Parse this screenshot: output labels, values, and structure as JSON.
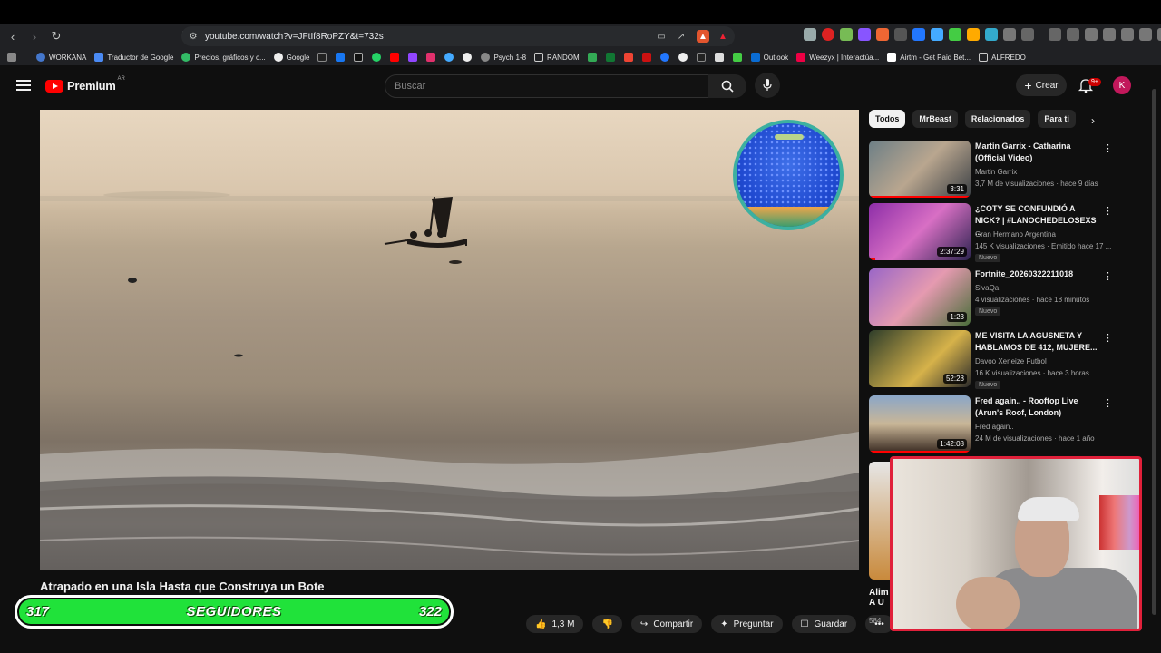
{
  "browser": {
    "url": "youtube.com/watch?v=JFtIf8RoPZY&t=732s",
    "bookmarks": [
      "WORKANA",
      "Traductor de Google",
      "Precios, gráficos y c...",
      "Google",
      "Psych 1-8",
      "RANDOM",
      "Outlook",
      "Weezyx | Interactúa...",
      "Airtm - Get Paid Bet...",
      "ALFREDO"
    ]
  },
  "youtube": {
    "logo_text": "Premium",
    "country": "AR",
    "search_placeholder": "Buscar",
    "create_label": "Crear",
    "notif_badge": "9+",
    "avatar_letter": "K"
  },
  "video": {
    "title": "Atrapado en una Isla Hasta que Construya un Bote",
    "likes": "1,3 M",
    "share_label": "Compartir",
    "ask_label": "Preguntar",
    "save_label": "Guardar"
  },
  "followers_overlay": {
    "current": "317",
    "label": "SEGUIDORES",
    "goal": "322"
  },
  "chips": [
    "Todos",
    "MrBeast",
    "Relacionados",
    "Para ti"
  ],
  "recommendations": [
    {
      "title": "Martin Garrix - Catharina (Official Video)",
      "channel": "Martin Garrix",
      "meta": "3,7 M de visualizaciones · hace 9 días",
      "duration": "3:31",
      "nuevo": ""
    },
    {
      "title": "¿COTY SE CONFUNDIÓ A NICK? | #LANOCHEDELOSEXS ...",
      "channel": "Gran Hermano Argentina",
      "meta": "145 K visualizaciones · Emitido hace 17 ...",
      "duration": "2:37:29",
      "nuevo": "Nuevo"
    },
    {
      "title": "Fortnite_20260322211018",
      "channel": "SlvaQa",
      "meta": "4 visualizaciones · hace 18 minutos",
      "duration": "1:23",
      "nuevo": "Nuevo"
    },
    {
      "title": "ME VISITA LA AGUSNETA Y HABLAMOS DE 412, MUJERE...",
      "channel": "Davoo Xeneize Futbol",
      "meta": "16 K visualizaciones · hace 3 horas",
      "duration": "52:28",
      "nuevo": "Nuevo"
    },
    {
      "title": "Fred again.. - Rooftop Live (Arun's Roof, London)",
      "channel": "Fred again..",
      "meta": "24 M de visualizaciones · hace 1 año",
      "duration": "1:42:08",
      "nuevo": ""
    }
  ],
  "partial_rec": {
    "title_line1": "Alim",
    "title_line2": "A U",
    "meta": "584"
  }
}
